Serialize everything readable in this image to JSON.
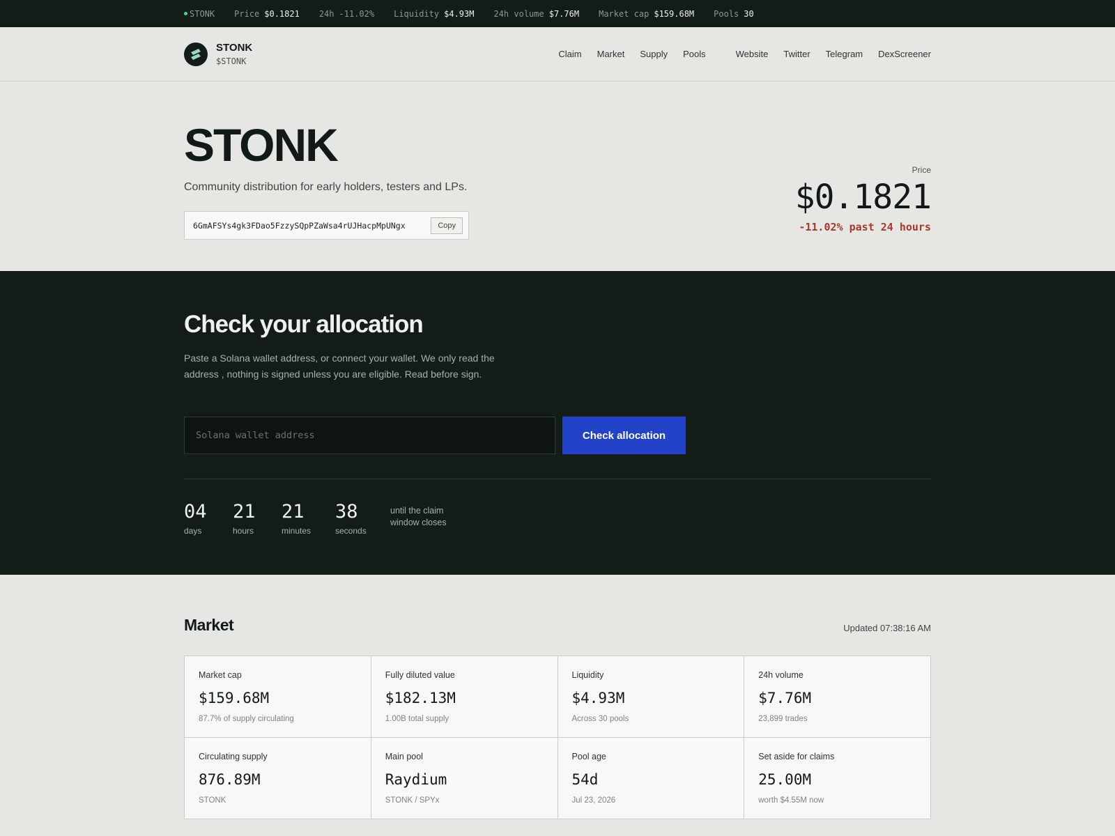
{
  "ticker": {
    "symbol": "STONK",
    "items": [
      {
        "label": "Price",
        "value": "$0.1821"
      },
      {
        "label": "24h",
        "value": "-11.02%"
      },
      {
        "label": "Liquidity",
        "value": "$4.93M"
      },
      {
        "label": "24h volume",
        "value": "$7.76M"
      },
      {
        "label": "Market cap",
        "value": "$159.68M"
      },
      {
        "label": "Pools",
        "value": "30"
      }
    ]
  },
  "nav": {
    "brand_name": "STONK",
    "brand_ticker": "$STONK",
    "links": [
      "Claim",
      "Market",
      "Supply",
      "Pools"
    ],
    "external_links": [
      "Website",
      "Twitter",
      "Telegram",
      "DexScreener"
    ]
  },
  "hero": {
    "title": "STONK",
    "subtitle": "Community distribution for early holders, testers and LPs.",
    "address": "6GmAFSYs4gk3FDao5FzzySQpPZaWsa4rUJHacpMpUNgx",
    "copy_label": "Copy",
    "price_label": "Price",
    "price": "$0.1821",
    "change": "-11.02% past 24 hours"
  },
  "check": {
    "title": "Check your allocation",
    "description": "Paste a Solana wallet address, or connect your wallet. We only read the address , nothing is signed unless you are eligible. Read before sign.",
    "input_placeholder": "Solana wallet address",
    "button_label": "Check allocation",
    "countdown": [
      {
        "value": "04",
        "unit": "days"
      },
      {
        "value": "21",
        "unit": "hours"
      },
      {
        "value": "21",
        "unit": "minutes"
      },
      {
        "value": "38",
        "unit": "seconds"
      }
    ],
    "countdown_note": "until the claim window closes"
  },
  "market": {
    "title": "Market",
    "updated": "Updated 07:38:16 AM",
    "cells": [
      {
        "label": "Market cap",
        "value": "$159.68M",
        "sub": "87.7% of supply circulating"
      },
      {
        "label": "Fully diluted value",
        "value": "$182.13M",
        "sub": "1.00B total supply"
      },
      {
        "label": "Liquidity",
        "value": "$4.93M",
        "sub": "Across 30 pools"
      },
      {
        "label": "24h volume",
        "value": "$7.76M",
        "sub": "23,899 trades"
      },
      {
        "label": "Circulating supply",
        "value": "876.89M",
        "sub": "STONK"
      },
      {
        "label": "Main pool",
        "value": "Raydium",
        "sub": "STONK / SPYx"
      },
      {
        "label": "Pool age",
        "value": "54d",
        "sub": "Jul 23, 2026"
      },
      {
        "label": "Set aside for claims",
        "value": "25.00M",
        "sub": "worth $4.55M now"
      }
    ]
  },
  "colors": {
    "dark_bg": "#141c18",
    "light_bg": "#e6e7e2",
    "accent_blue": "#2242c8",
    "negative_red": "#a6392c",
    "live_green": "#3ddc84"
  }
}
